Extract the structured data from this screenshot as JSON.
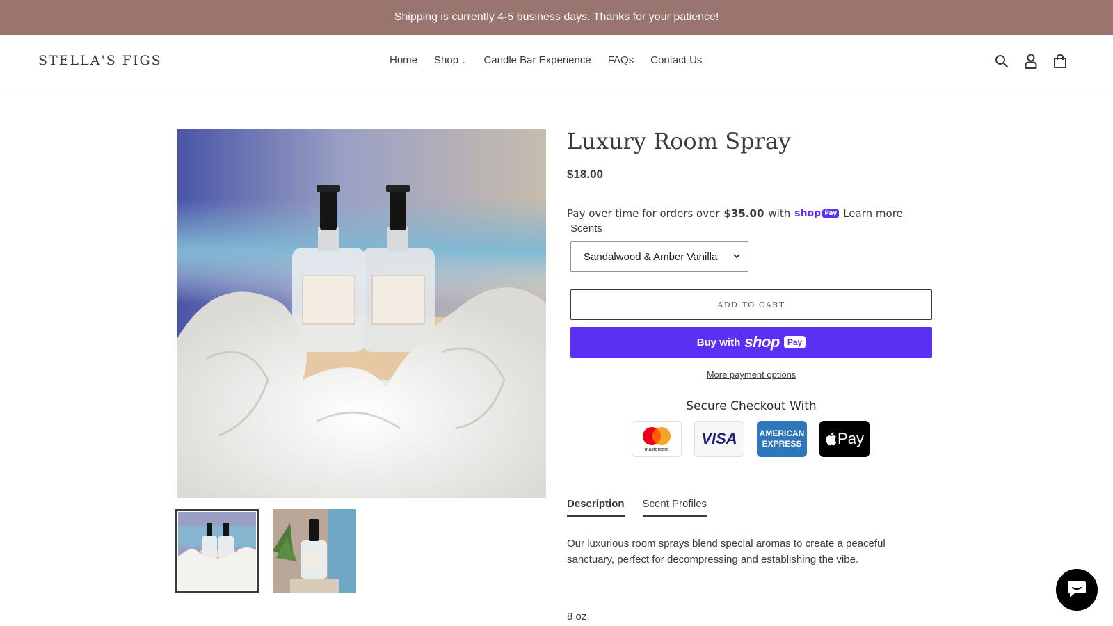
{
  "announcement": {
    "text": "Shipping is currently 4-5 business days. Thanks for your patience!"
  },
  "header": {
    "logo": "STELLA'S FIGS",
    "nav": [
      {
        "label": "Home"
      },
      {
        "label": "Shop"
      },
      {
        "label": "Candle Bar Experience"
      },
      {
        "label": "FAQs"
      },
      {
        "label": "Contact Us"
      }
    ],
    "icons": [
      "search-icon",
      "account-icon",
      "cart-icon"
    ]
  },
  "product": {
    "title": "Luxury Room Spray",
    "price": "$18.00",
    "installments": {
      "prefix": "Pay over time for orders over",
      "amount": "$35.00",
      "with": "with",
      "shop_word": "shop",
      "pay_word": "Pay",
      "learn_more": "Learn more"
    },
    "option_label": "Scents",
    "selected_scent": "Sandalwood & Amber Vanilla",
    "add_to_cart": "ADD TO CART",
    "buy_with": "Buy with",
    "shop_pay_word": "shop",
    "shop_pay_badge": "Pay",
    "more_payment": "More payment options",
    "secure_title": "Secure Checkout With",
    "payment_cards": {
      "mastercard": "mastercard",
      "visa": "VISA",
      "amex_line1": "AMERICAN",
      "amex_line2": "EXPRESS",
      "apple_pay": "Pay"
    },
    "tabs": [
      {
        "label": "Description",
        "active": true
      },
      {
        "label": "Scent Profiles",
        "active": false
      }
    ],
    "description": "Our luxurious room sprays blend special aromas to create a peaceful sanctuary, perfect for decompressing and establishing the vibe.",
    "size": "8 oz."
  },
  "colors": {
    "announcement_bg": "#9a7570",
    "shop_pay": "#5a31f4",
    "text": "#3a3a3a"
  }
}
